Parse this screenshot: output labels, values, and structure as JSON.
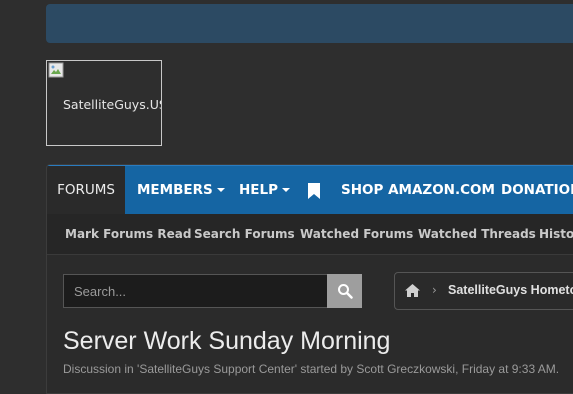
{
  "logo": {
    "alt_text": "SatelliteGuys.US"
  },
  "nav": {
    "tabs": [
      {
        "label": "FORUMS",
        "active": true
      },
      {
        "label": "MEMBERS",
        "dropdown": true
      },
      {
        "label": "HELP",
        "dropdown": true
      },
      {
        "label": "SHOP AMAZON.COM"
      },
      {
        "label": "DONATIONS"
      }
    ],
    "bookmark_icon": "bookmark-icon"
  },
  "subnav": {
    "links": [
      "Mark Forums Read",
      "Search Forums",
      "Watched Forums",
      "Watched Threads",
      "History"
    ]
  },
  "search": {
    "placeholder": "Search...",
    "button_icon": "search-icon"
  },
  "breadcrumb": {
    "home_icon": "home-icon",
    "current": "SatelliteGuys Hometown"
  },
  "thread": {
    "title": "Server Work Sunday Morning",
    "meta": "Discussion in 'SatelliteGuys Support Center' started by Scott Greczkowski, Friday at 9:33 AM."
  },
  "colors": {
    "nav_blue": "#1565a3",
    "banner": "#2c4a63",
    "background": "#2e2e2e"
  }
}
